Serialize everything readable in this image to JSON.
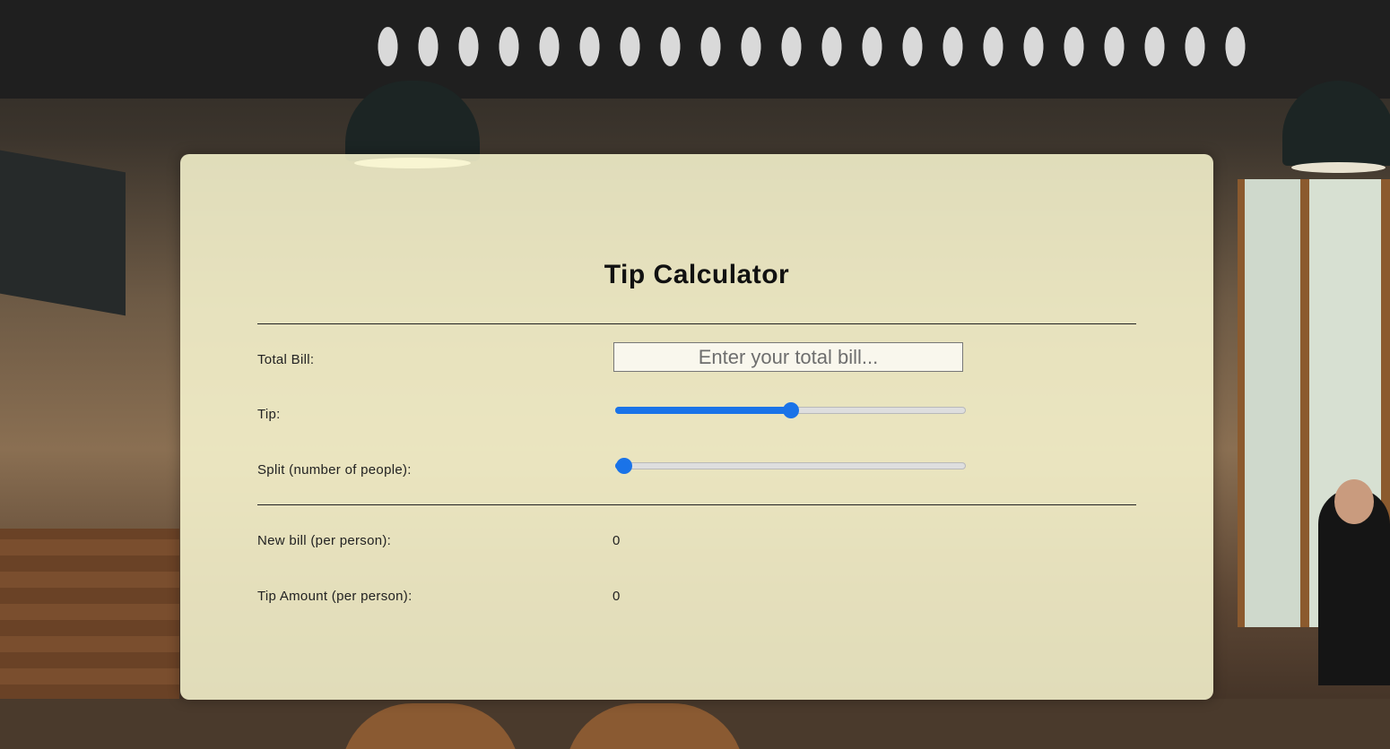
{
  "app": {
    "title": "Tip Calculator"
  },
  "form": {
    "total_bill_label": "Total Bill:",
    "total_bill_placeholder": "Enter your total bill...",
    "total_bill_value": "",
    "tip_label": "Tip:",
    "tip_slider_level": 0.5,
    "split_label": "Split (number of people):",
    "split_slider_level": 0.0
  },
  "results": {
    "new_bill_label": "New bill (per person):",
    "new_bill_value": "0",
    "tip_amount_label": "Tip Amount (per person):",
    "tip_amount_value": "0"
  },
  "colors": {
    "accent": "#1a73e8",
    "card_background": "#faf8d2"
  }
}
